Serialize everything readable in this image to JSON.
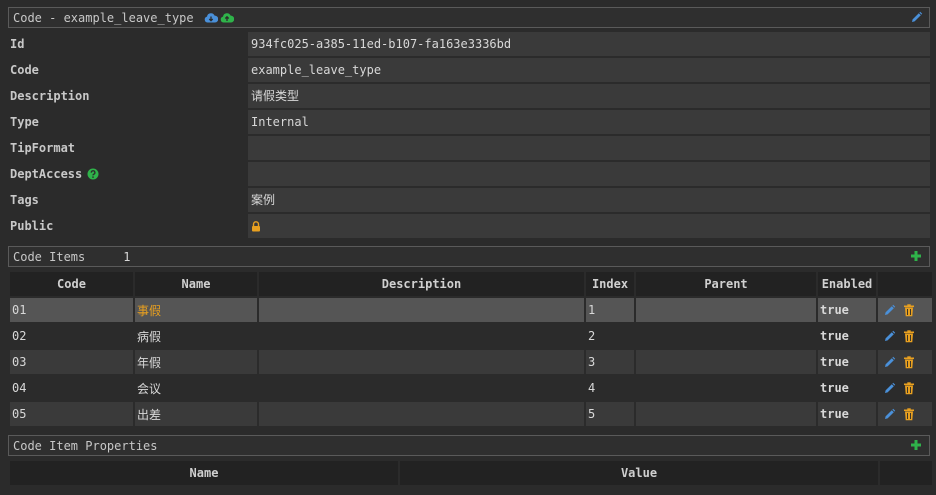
{
  "header": {
    "title": "Code - example_leave_type"
  },
  "properties": [
    {
      "label": "Id",
      "value": "934fc025-a385-11ed-b107-fa163e3336bd"
    },
    {
      "label": "Code",
      "value": "example_leave_type"
    },
    {
      "label": "Description",
      "value": "请假类型"
    },
    {
      "label": "Type",
      "value": "Internal"
    },
    {
      "label": "TipFormat",
      "value": ""
    },
    {
      "label": "DeptAccess",
      "value": ""
    },
    {
      "label": "Tags",
      "value": "案例"
    },
    {
      "label": "Public",
      "value": ""
    }
  ],
  "code_items": {
    "title": "Code Items",
    "count": "1",
    "columns": [
      "Code",
      "Name",
      "Description",
      "Index",
      "Parent",
      "Enabled"
    ],
    "rows": [
      {
        "code": "01",
        "name": "事假",
        "description": "",
        "index": "1",
        "parent": "",
        "enabled": "true"
      },
      {
        "code": "02",
        "name": "病假",
        "description": "",
        "index": "2",
        "parent": "",
        "enabled": "true"
      },
      {
        "code": "03",
        "name": "年假",
        "description": "",
        "index": "3",
        "parent": "",
        "enabled": "true"
      },
      {
        "code": "04",
        "name": "会议",
        "description": "",
        "index": "4",
        "parent": "",
        "enabled": "true"
      },
      {
        "code": "05",
        "name": "出差",
        "description": "",
        "index": "5",
        "parent": "",
        "enabled": "true"
      }
    ]
  },
  "code_item_properties": {
    "title": "Code Item Properties",
    "columns": [
      "Name",
      "Value"
    ]
  },
  "colors": {
    "accent_blue": "#4a90d9",
    "accent_green": "#2fb34a",
    "accent_orange": "#e8a020"
  },
  "icons": {
    "cloud_download": "cloud-download-icon",
    "cloud_upload": "cloud-upload-icon",
    "edit": "pencil-icon",
    "help": "question-circle-icon",
    "lock": "lock-icon",
    "add": "plus-icon",
    "delete": "trash-icon"
  }
}
